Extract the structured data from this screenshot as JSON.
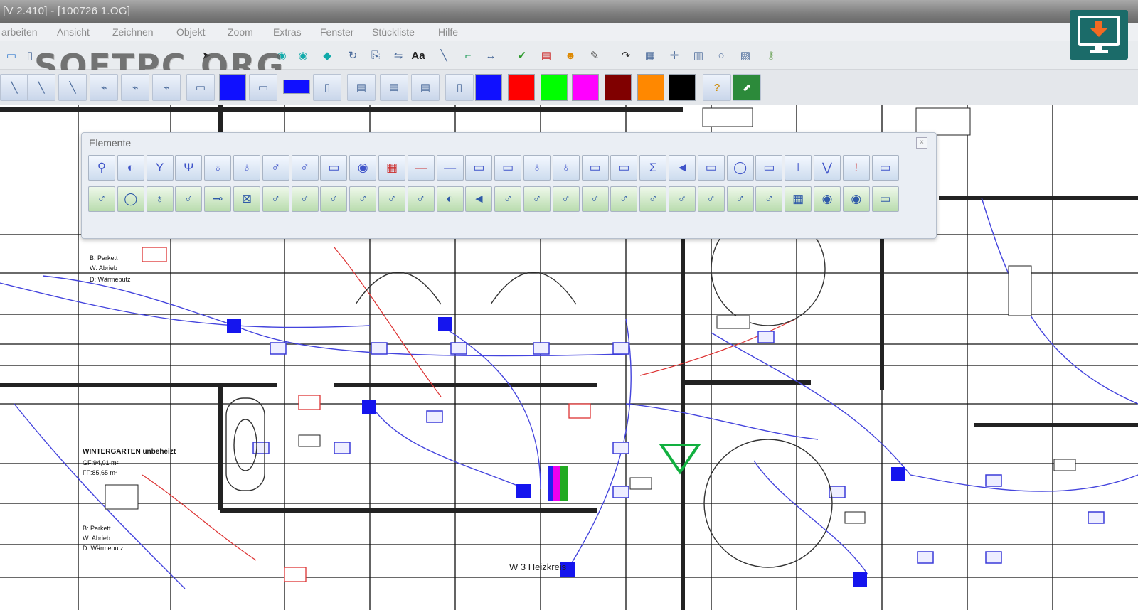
{
  "window": {
    "title": "[V 2.410] - [100726 1.OG]"
  },
  "menu": [
    "arbeiten",
    "Ansicht",
    "Zeichnen",
    "Objekt",
    "Zoom",
    "Extras",
    "Fenster",
    "Stückliste",
    "Hilfe"
  ],
  "watermark": "SOFTPC.ORG",
  "toolbar_text_tool": "Aa",
  "colors": [
    "#1010ff",
    "#ff0000",
    "#00ff00",
    "#ff00ff",
    "#800000",
    "#ff8800",
    "#000000"
  ],
  "palette": {
    "title": "Elemente",
    "close_label": "×"
  },
  "plan": {
    "room_title": "WINTERGARTEN unbeheizt",
    "room_lines": [
      "GF:94,01 m²",
      "FF:85,65 m²"
    ],
    "floor_keys": [
      "B: Parkett",
      "W: Abrieb",
      "D: Wärmeputz"
    ],
    "circuit_label": "W 3 Heizkreis"
  }
}
